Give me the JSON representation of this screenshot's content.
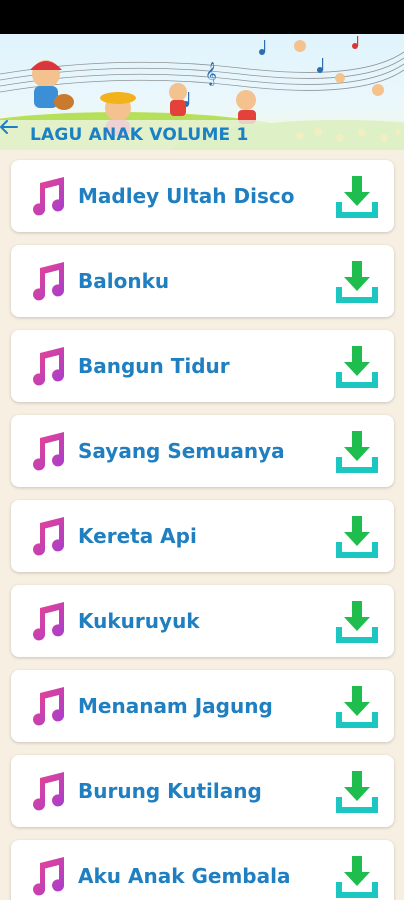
{
  "header": {
    "title": "LAGU ANAK VOLUME 1",
    "back_icon": "arrow-left-icon"
  },
  "songs": [
    {
      "title": "Madley Ultah Disco"
    },
    {
      "title": "Balonku"
    },
    {
      "title": "Bangun Tidur"
    },
    {
      "title": "Sayang Semuanya"
    },
    {
      "title": "Kereta Api"
    },
    {
      "title": "Kukuruyuk"
    },
    {
      "title": "Menanam Jagung"
    },
    {
      "title": "Burung Kutilang"
    },
    {
      "title": "Aku Anak Gembala"
    }
  ],
  "icons": {
    "song": "music-note-icon",
    "action": "download-icon"
  },
  "colors": {
    "title_text": "#1b80c4",
    "note_gradient": [
      "#ee3f8f",
      "#9b3fd3"
    ],
    "download_green": "#1fbd4e",
    "download_tray": "#1cc7c1",
    "background": "#f6efe2"
  }
}
